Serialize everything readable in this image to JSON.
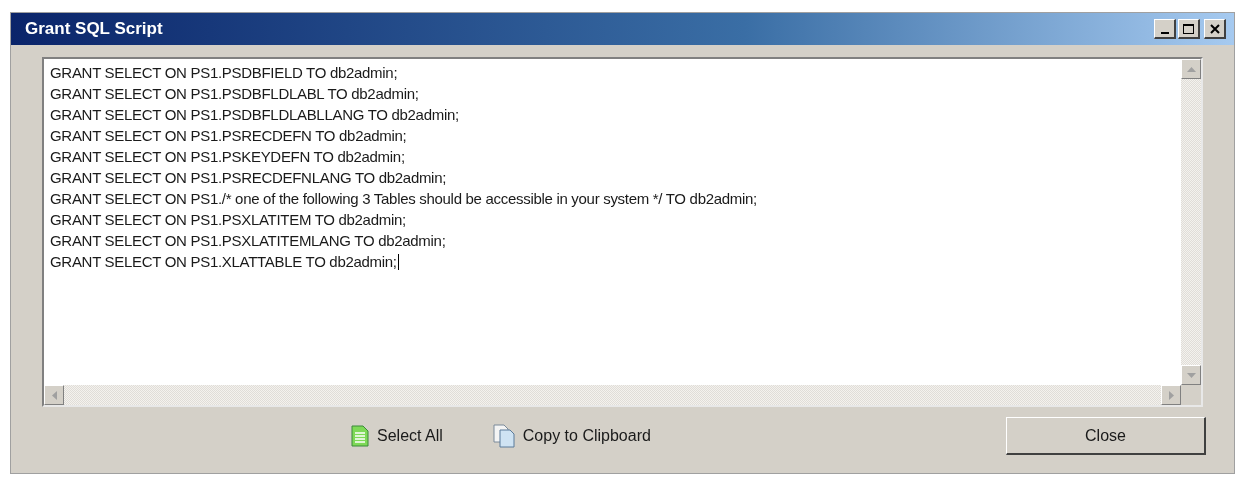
{
  "window": {
    "title": "Grant SQL Script"
  },
  "script_lines": [
    "GRANT SELECT ON PS1.PSDBFIELD TO db2admin;",
    "GRANT SELECT ON PS1.PSDBFLDLABL TO db2admin;",
    "GRANT SELECT ON PS1.PSDBFLDLABLLANG TO db2admin;",
    "GRANT SELECT ON PS1.PSRECDEFN TO db2admin;",
    "GRANT SELECT ON PS1.PSKEYDEFN TO db2admin;",
    "GRANT SELECT ON PS1.PSRECDEFNLANG TO db2admin;",
    "GRANT SELECT ON PS1./* one of the following 3 Tables should be accessible in your system */ TO db2admin;",
    "GRANT SELECT ON PS1.PSXLATITEM TO db2admin;",
    "GRANT SELECT ON PS1.PSXLATITEMLANG TO db2admin;",
    "GRANT SELECT ON PS1.XLATTABLE TO db2admin;"
  ],
  "actions": [
    {
      "kind": "select_all",
      "label": "Select All"
    },
    {
      "kind": "copy",
      "label": "Copy to Clipboard"
    }
  ],
  "close_button": "Close"
}
